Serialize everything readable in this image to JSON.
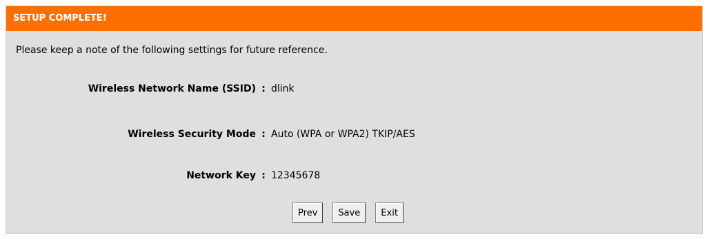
{
  "header": {
    "title": "SETUP COMPLETE!"
  },
  "intro": "Please keep a note of the following settings for future reference.",
  "settings": [
    {
      "label": "Wireless Network Name (SSID)",
      "separator": ":",
      "value": "dlink"
    },
    {
      "label": "Wireless Security Mode",
      "separator": ":",
      "value": "Auto (WPA or WPA2) TKIP/AES"
    },
    {
      "label": "Network Key",
      "separator": ":",
      "value": "12345678"
    }
  ],
  "buttons": {
    "prev": "Prev",
    "save": "Save",
    "exit": "Exit"
  },
  "colors": {
    "header_bg": "#ff6f00",
    "panel_bg": "#dfdfdf"
  }
}
